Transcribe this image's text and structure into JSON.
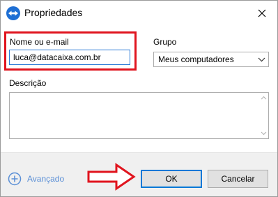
{
  "window": {
    "title": "Propriedades",
    "close_icon": "close-icon",
    "app_icon": "teamviewer-logo-icon"
  },
  "form": {
    "name_label": "Nome ou e-mail",
    "name_value": "luca@datacaixa.com.br",
    "group_label": "Grupo",
    "group_value": "Meus computadores",
    "description_label": "Descrição",
    "description_value": ""
  },
  "footer": {
    "advanced_label": "Avançado",
    "ok_label": "OK",
    "cancel_label": "Cancelar"
  },
  "colors": {
    "highlight": "#e0141e",
    "accent": "#0078d7",
    "link": "#5a8fd6"
  }
}
